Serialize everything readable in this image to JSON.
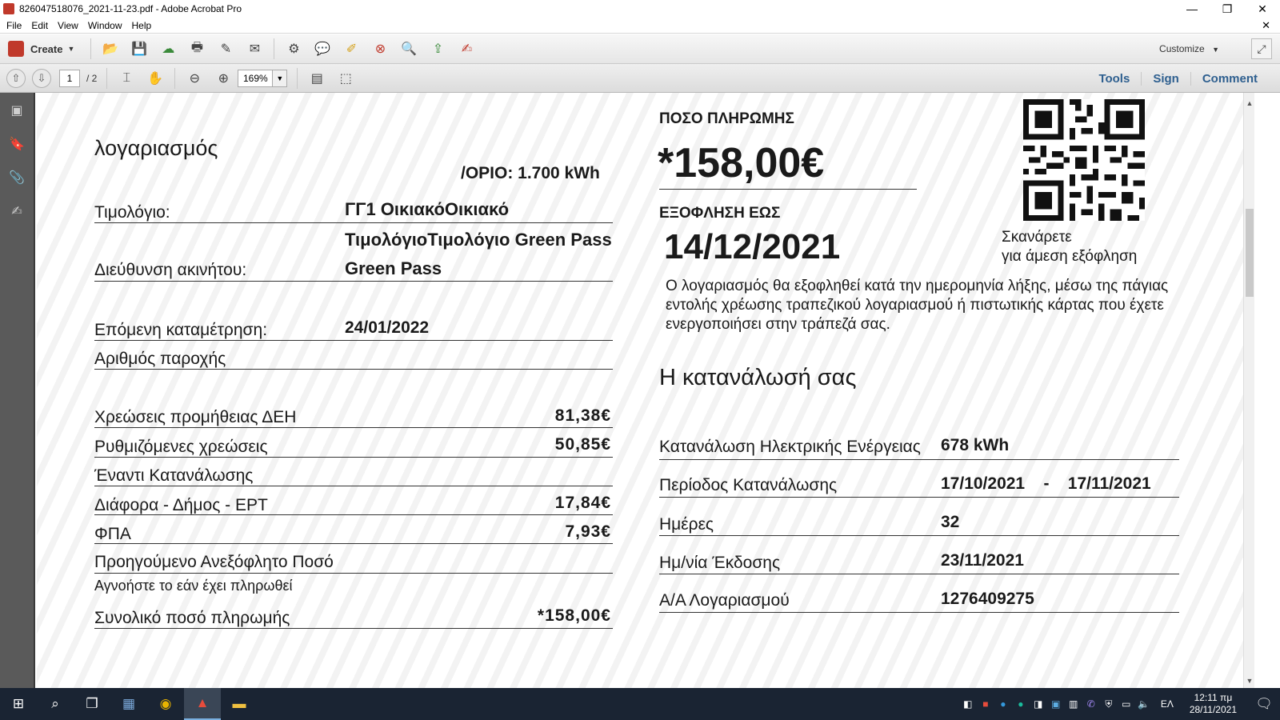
{
  "window": {
    "title": "826047518076_2021-11-23.pdf - Adobe Acrobat Pro",
    "minimize": "—",
    "restore": "❐",
    "close": "✕"
  },
  "menu": {
    "items": [
      "File",
      "Edit",
      "View",
      "Window",
      "Help"
    ],
    "doc_close": "✕"
  },
  "toolbar": {
    "create_label": "Create",
    "customize_label": "Customize",
    "page_current": "1",
    "page_total": "/ 2",
    "zoom": "169%",
    "tools": "Tools",
    "sign": "Sign",
    "comment": "Comment"
  },
  "bill": {
    "title": "λογαριασμός",
    "limit": "/ΟΡΙΟ: 1.700 kWh",
    "tariff_label": "Τιμολόγιο:",
    "tariff_value_1": "ΓΓ1   ΟικιακόΟικιακό",
    "tariff_value_2": "ΤιμολόγιοΤιμολόγιο  Green Pass",
    "address_label": "Διεύθυνση ακινήτου:",
    "address_value": "Green Pass",
    "next_reading_label": "Επόμενη καταμέτρηση:",
    "next_reading_value": "24/01/2022",
    "supply_number_label": "Αριθμός παροχής",
    "charges": [
      {
        "label": "Χρεώσεις προμήθειας ΔΕΗ",
        "value": "81,38€"
      },
      {
        "label": "Ρυθμιζόμενες χρεώσεις",
        "value": "50,85€"
      },
      {
        "label": "Έναντι Κατανάλωσης",
        "value": ""
      },
      {
        "label": "Διάφορα - Δήμος - ΕΡΤ",
        "value": "17,84€"
      },
      {
        "label": "ΦΠΑ",
        "value": "7,93€"
      },
      {
        "label": "Προηγούμενο Ανεξόφλητο Ποσό",
        "value": ""
      }
    ],
    "ignore_note": "Αγνοήστε το εάν έχει πληρωθεί",
    "total_label": "Συνολικό ποσό πληρωμής",
    "total_value": "*158,00€",
    "payment_amount_label": "ΠΟΣΟ ΠΛΗΡΩΜΗΣ",
    "payment_amount_value": "*158,00€",
    "due_label": "ΕΞΟΦΛΗΣΗ ΕΩΣ",
    "due_value": "14/12/2021",
    "scan_line_1": "Σκανάρετε",
    "scan_line_2": "για άμεση εξόφληση",
    "notice": "Ο λογαριασμός θα εξοφληθεί κατά την ημερομηνία λήξης, μέσω της πάγιας εντολής χρέωσης τραπεζικού λογαριασμού ή πιστωτικής κάρτας που έχετε ενεργοποιήσει στην τράπεζά σας.",
    "consumption_heading": "Η κατανάλωσή σας",
    "consumption": [
      {
        "label": "Κατανάλωση Ηλεκτρικής Ενέργειας",
        "value": "678 kWh"
      },
      {
        "label": "Περίοδος Κατανάλωσης",
        "value": "17/10/2021    -    17/11/2021"
      },
      {
        "label": "Ημέρες",
        "value": "32"
      },
      {
        "label": "Ημ/νία Έκδοσης",
        "value": "23/11/2021"
      },
      {
        "label": "Α/Α Λογαριασμού",
        "value": "1276409275"
      }
    ]
  },
  "taskbar": {
    "language": "ΕΛ",
    "time": "12:11 πμ",
    "date": "28/11/2021"
  },
  "colors": {
    "taskbar_bg": "#1a2433",
    "link_blue": "#2e5f8f",
    "text": "#1a1a1a"
  }
}
